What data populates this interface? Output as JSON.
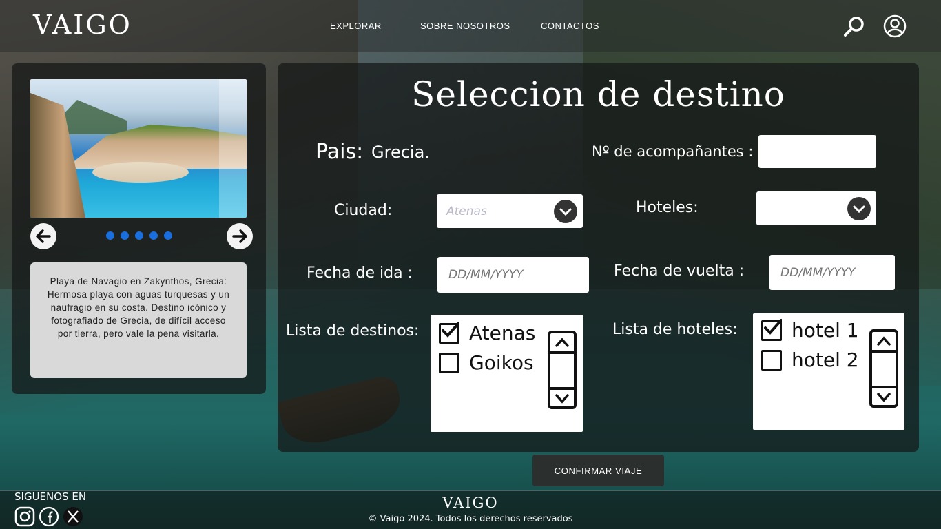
{
  "header": {
    "logo": "VAIGO",
    "nav": [
      "EXPLORAR",
      "SOBRE NOSOTROS",
      "CONTACTOS"
    ],
    "icons": [
      "search-icon",
      "user-icon"
    ]
  },
  "carousel": {
    "image_alt": "Playa de Navagio en Zakynthos",
    "dots": 5,
    "description": "Playa de Navagio en Zakynthos, Grecia: Hermosa playa con aguas turquesas y un naufragio en su costa. Destino icónico y fotografiado de Grecia, de difícil acceso por tierra, pero vale la pena visitarla."
  },
  "form": {
    "title": "Seleccion de destino",
    "pais_label": "Pais:",
    "pais_value": "Grecia.",
    "acompanantes_label": "Nº  de acompañantes :",
    "acompanantes_value": "",
    "ciudad_label": "Ciudad:",
    "ciudad_value": "Atenas",
    "hoteles_label": "Hoteles:",
    "hoteles_value": "",
    "fecha_ida_label": "Fecha de ida :",
    "fecha_ida_placeholder": "DD/MM/YYYY",
    "fecha_vuelta_label": "Fecha de vuelta :",
    "fecha_vuelta_placeholder": "DD/MM/YYYY",
    "destinos_label": "Lista de destinos:",
    "destinos": [
      {
        "label": "Atenas",
        "checked": true
      },
      {
        "label": "Goikos",
        "checked": false
      }
    ],
    "hoteles_list_label": "Lista de hoteles:",
    "hoteles_list": [
      {
        "label": "hotel 1",
        "checked": true
      },
      {
        "label": "hotel 2",
        "checked": false
      }
    ],
    "confirm_label": "CONFIRMAR VIAJE"
  },
  "footer": {
    "follow_label": "SIGUENOS EN",
    "social": [
      "instagram-icon",
      "facebook-icon",
      "x-icon"
    ],
    "logo": "VAIGO",
    "copyright": "© Vaigo 2024. Todos los derechos reservados"
  },
  "colors": {
    "accent_dot": "#1a6fe0",
    "panel": "#141616",
    "button": "#2b2f2e"
  }
}
